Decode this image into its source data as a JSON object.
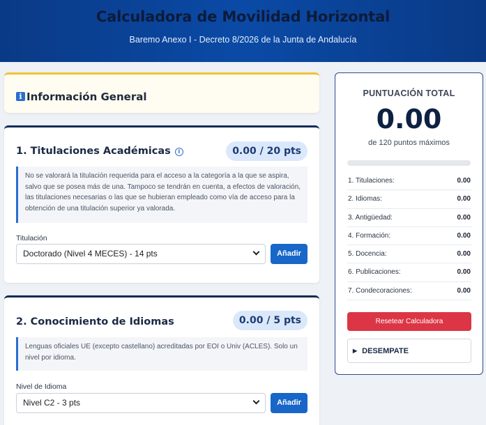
{
  "header": {
    "title": "Calculadora de Movilidad Horizontal",
    "subtitle": "Baremo Anexo I - Decreto 8/2026 de la Junta de Andalucía"
  },
  "info": {
    "icon": "info-icon",
    "title": "Información General"
  },
  "sections": [
    {
      "title": "1. Titulaciones Académicas",
      "help_icon": "info-circle-icon",
      "points": "0.00 / 20 pts",
      "note": "No se valorará la titulación requerida para el acceso a la categoría a la que se aspira, salvo que se posea más de una. Tampoco se tendrán en cuenta, a efectos de valoración, las titulaciones necesarias o las que se hubieran empleado como vía de acceso para la obtención de una titulación superior ya valorada.",
      "field_label": "Titulación",
      "selected": "Doctorado (Nivel 4 MECES) - 14 pts",
      "add_label": "Añadir"
    },
    {
      "title": "2. Conocimiento de Idiomas",
      "points": "0.00 / 5 pts",
      "note": "Lenguas oficiales UE (excepto castellano) acreditadas por EOI o Univ (ACLES). Solo un nivel por idioma.",
      "field_label": "Nivel de Idioma",
      "selected": "Nivel C2 - 3 pts",
      "add_label": "Añadir"
    }
  ],
  "summary": {
    "label": "PUNTUACIÓN TOTAL",
    "total": "0.00",
    "max_text": "de 120 puntos máximos",
    "progress": 0,
    "accent": "#1766c8",
    "breakdown": [
      {
        "label": "1. Titulaciones:",
        "value": "0.00"
      },
      {
        "label": "2. Idiomas:",
        "value": "0.00"
      },
      {
        "label": "3. Antigüedad:",
        "value": "0.00"
      },
      {
        "label": "4. Formación:",
        "value": "0.00"
      },
      {
        "label": "5. Docencia:",
        "value": "0.00"
      },
      {
        "label": "6. Publicaciones:",
        "value": "0.00"
      },
      {
        "label": "7. Condecoraciones:",
        "value": "0.00"
      }
    ],
    "reset_label": "Resetear Calculadora",
    "reset_color": "#dc3545",
    "tiebreak_label": "DESEMPATE"
  }
}
